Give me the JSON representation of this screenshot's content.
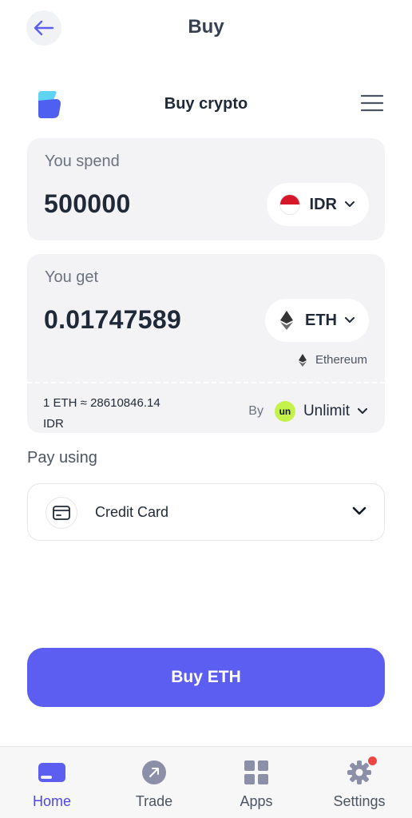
{
  "header": {
    "title": "Buy",
    "back_icon": "arrow-left-icon"
  },
  "widget": {
    "title": "Buy crypto",
    "menu_icon": "hamburger-menu-icon"
  },
  "spend": {
    "label": "You spend",
    "amount": "500000",
    "currency": "IDR"
  },
  "get": {
    "label": "You get",
    "amount": "0.01747589",
    "currency": "ETH",
    "network": "Ethereum"
  },
  "rate": {
    "text": "1 ETH ≈ 28610846.14 IDR"
  },
  "provider": {
    "by_label": "By",
    "logo_text": "un",
    "name": "Unlimit"
  },
  "payment": {
    "label": "Pay using",
    "method": "Credit Card"
  },
  "buy_button": {
    "label": "Buy ETH"
  },
  "bottom_nav": [
    {
      "label": "Home",
      "icon": "wallet-icon",
      "active": true
    },
    {
      "label": "Trade",
      "icon": "trade-icon",
      "active": false
    },
    {
      "label": "Apps",
      "icon": "apps-grid-icon",
      "active": false
    },
    {
      "label": "Settings",
      "icon": "gear-icon",
      "active": false
    }
  ],
  "colors": {
    "accent": "#5b5ef0",
    "card_bg": "#f3f3f5",
    "provider_green": "#c5f24a",
    "notification_red": "#ef4444"
  }
}
